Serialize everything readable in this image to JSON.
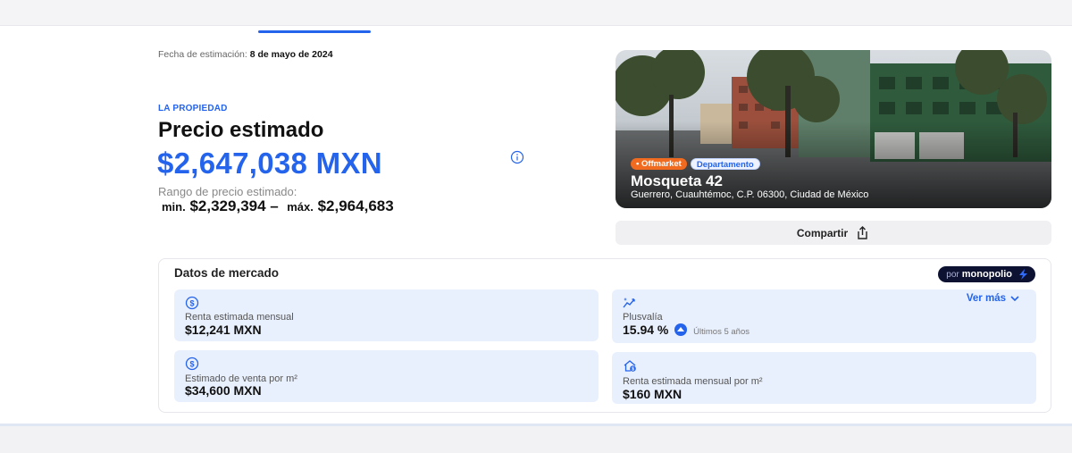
{
  "header": {
    "est_date_label": "Fecha de estimación:",
    "est_date_value": "8 de mayo de 2024"
  },
  "property": {
    "overline": "LA PROPIEDAD",
    "title": "Precio estimado",
    "price": "$2,647,038 MXN",
    "range_label": "Rango de precio estimado:",
    "min_label": "min.",
    "min_value": "$2,329,394",
    "dash": "–",
    "max_label": "máx.",
    "max_value": "$2,964,683"
  },
  "photo": {
    "badges": [
      "• Offmarket",
      "Departamento"
    ],
    "name": "Mosqueta 42",
    "address": "Guerrero, Cuauhtémoc, C.P. 06300, Ciudad de México"
  },
  "share": {
    "label": "Compartir",
    "icon": "share-icon"
  },
  "market": {
    "title": "Datos de mercado",
    "provider_prefix": "por",
    "provider_name": "monopolio",
    "cards": [
      {
        "icon": "dollar-coin-icon",
        "label": "Renta estimada mensual",
        "value": "$12,241 MXN"
      },
      {
        "icon": "trend-sparkle-icon",
        "label": "Plusvalía",
        "value": "15.94 %",
        "period": "Últimos 5 años",
        "link": "Ver más"
      },
      {
        "icon": "dollar-coin-icon",
        "label": "Estimado de venta por m²",
        "value": "$34,600 MXN"
      },
      {
        "icon": "house-coin-icon",
        "label": "Renta estimada mensual por m²",
        "value": "$160 MXN"
      }
    ]
  },
  "colors": {
    "accent": "#2463eb",
    "badge_orange": "#f06a1f",
    "card_bg": "#e9f0fd",
    "provider_bg": "#0d1233"
  }
}
